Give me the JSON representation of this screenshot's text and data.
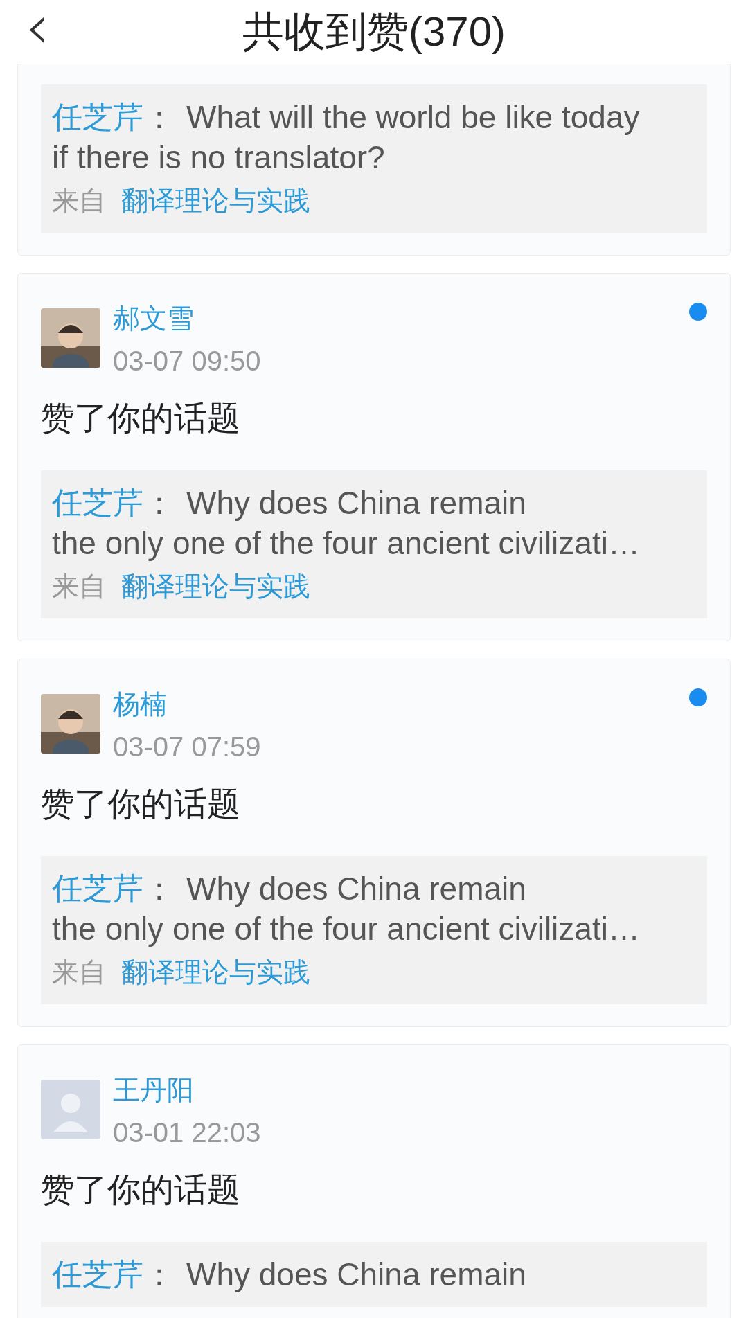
{
  "header": {
    "back_icon": "‹",
    "title": "共收到赞(370)"
  },
  "items": [
    {
      "quote": {
        "author": "任芝芹",
        "separator": "：",
        "lines": [
          "What will the world be like today",
          "if there is no translator?"
        ],
        "source_label": "来自",
        "source": "翻译理论与实践"
      }
    },
    {
      "user": "郝文雪",
      "time": "03-07 09:50",
      "unread": true,
      "action": "赞了你的话题",
      "quote": {
        "author": "任芝芹",
        "separator": "：",
        "lines": [
          "Why does China remain",
          "the only one of the four ancient civilizati…"
        ],
        "source_label": "来自",
        "source": "翻译理论与实践"
      }
    },
    {
      "user": "杨楠",
      "time": "03-07 07:59",
      "unread": true,
      "action": "赞了你的话题",
      "quote": {
        "author": "任芝芹",
        "separator": "：",
        "lines": [
          "Why does China remain",
          "the only one of the four ancient civilizati…"
        ],
        "source_label": "来自",
        "source": "翻译理论与实践"
      }
    },
    {
      "user": "王丹阳",
      "avatar": {
        "kind": "placeholder"
      },
      "time": "03-01 22:03",
      "unread": false,
      "action": "赞了你的话题",
      "quote": {
        "author": "任芝芹",
        "separator": "：",
        "lines": [
          "Why does China remain"
        ]
      }
    }
  ]
}
